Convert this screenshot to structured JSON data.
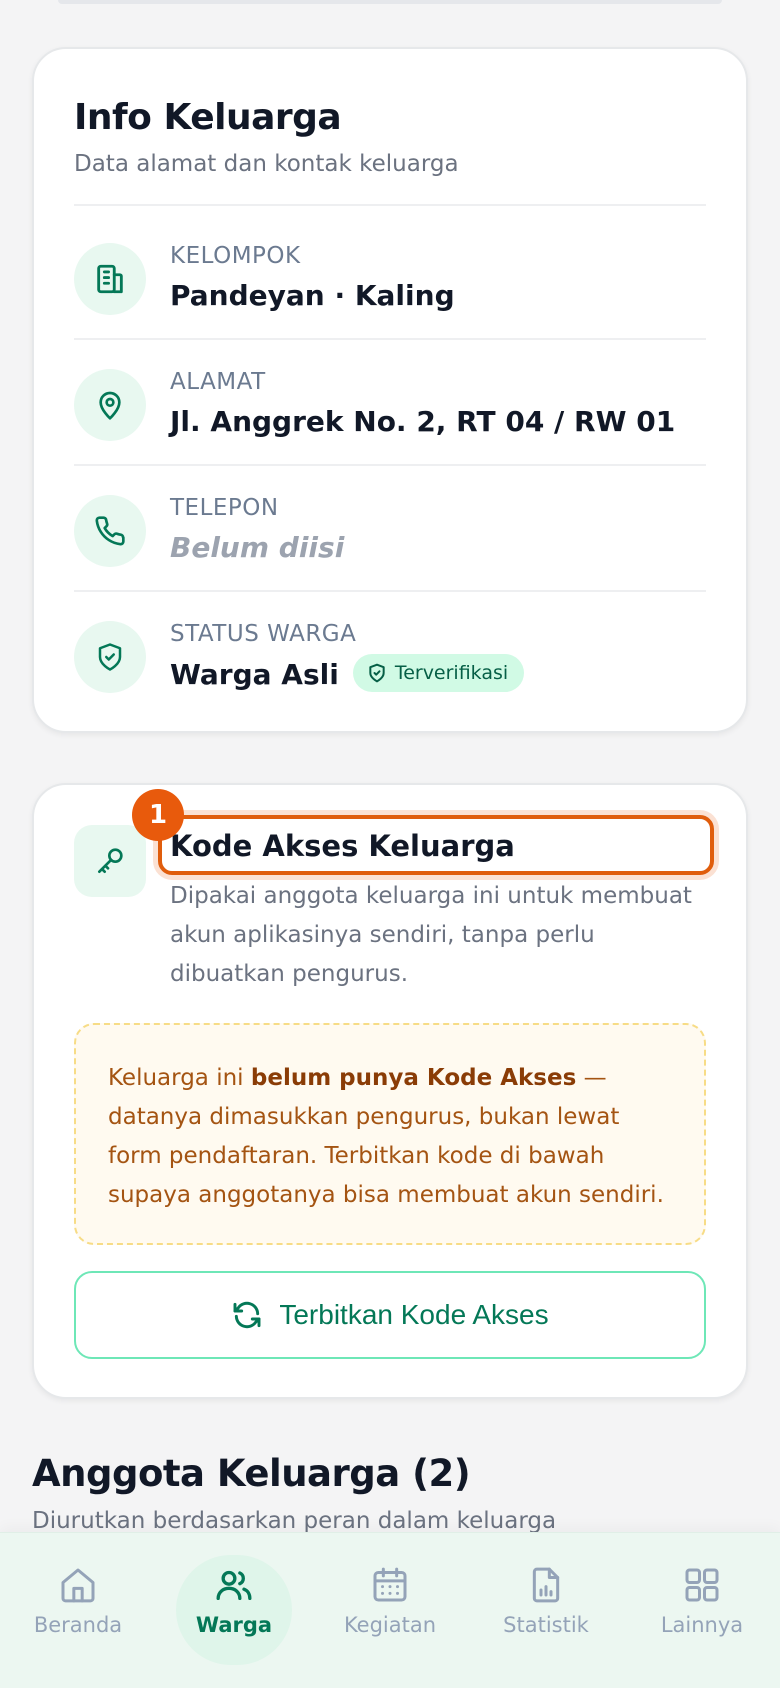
{
  "info": {
    "title": "Info Keluarga",
    "subtitle": "Data alamat dan kontak keluarga",
    "rows": [
      {
        "icon": "building-icon",
        "label": "KELOMPOK",
        "value": "Pandeyan · Kaling"
      },
      {
        "icon": "map-pin-icon",
        "label": "ALAMAT",
        "value": "Jl. Anggrek No. 2, RT 04 / RW 01"
      },
      {
        "icon": "phone-icon",
        "label": "TELEPON",
        "value": "Belum diisi"
      },
      {
        "icon": "shield-check-icon",
        "label": "STATUS WARGA",
        "value": "Warga Asli",
        "badge": "Terverifikasi"
      }
    ]
  },
  "access_code": {
    "marker": "1",
    "title": "Kode Akses Keluarga",
    "description": "Dipakai anggota keluarga ini untuk membuat akun aplikasinya sendiri, tanpa perlu dibuatkan pengurus.",
    "notice_prefix": "Keluarga ini ",
    "notice_bold": "belum punya Kode Akses",
    "notice_suffix": " — datanya dimasukkan pengurus, bukan lewat form pendaftaran. Terbitkan kode di bawah supaya anggotanya bisa membuat akun sendiri.",
    "button_label": "Terbitkan Kode Akses"
  },
  "members": {
    "title": "Anggota Keluarga (2)",
    "subtitle": "Diurutkan berdasarkan peran dalam keluarga"
  },
  "nav": {
    "items": [
      {
        "label": "Beranda",
        "icon": "home-icon",
        "active": false
      },
      {
        "label": "Warga",
        "icon": "users-icon",
        "active": true
      },
      {
        "label": "Kegiatan",
        "icon": "calendar-icon",
        "active": false
      },
      {
        "label": "Statistik",
        "icon": "chart-file-icon",
        "active": false
      },
      {
        "label": "Lainnya",
        "icon": "grid-icon",
        "active": false
      }
    ]
  },
  "colors": {
    "accent": "#047857",
    "icon_bg": "#e8f8f0",
    "marker": "#e85a0c",
    "notice_text": "#a45412"
  }
}
